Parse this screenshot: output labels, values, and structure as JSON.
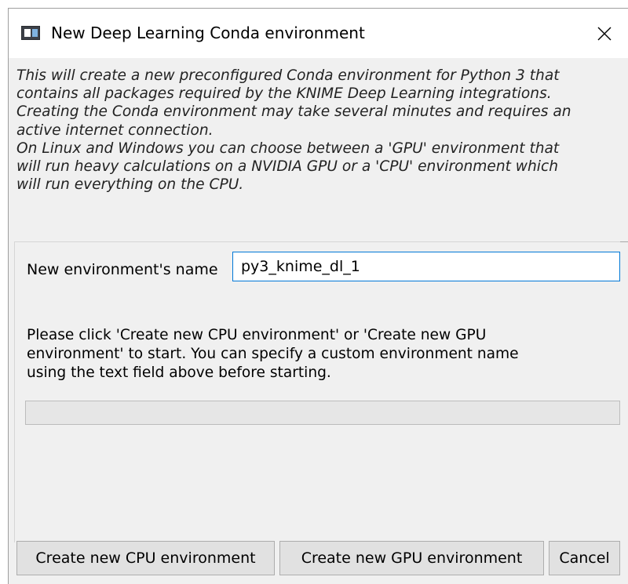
{
  "window": {
    "title": "New Deep Learning Conda environment",
    "close_icon": "close-icon"
  },
  "description": {
    "lines": [
      "This will create a new preconfigured Conda environment for Python 3 that",
      "contains all packages required by the KNIME Deep Learning integrations.",
      "Creating the Conda environment may take several minutes and requires an",
      "active internet connection.",
      "On Linux and Windows you can choose between a 'GPU' environment that",
      "will run heavy calculations on a NVIDIA GPU or a 'CPU' environment which",
      "will run everything on the CPU."
    ]
  },
  "form": {
    "name_label": "New environment's name",
    "name_value": "py3_knime_dl_1"
  },
  "info": {
    "lines": [
      "Please click 'Create new CPU environment' or 'Create new GPU",
      "environment' to start. You can specify a custom environment name",
      "using the text field above before starting."
    ]
  },
  "progress": {
    "value": 0
  },
  "buttons": {
    "create_cpu": "Create new CPU environment",
    "create_gpu": "Create new GPU environment",
    "cancel": "Cancel"
  }
}
